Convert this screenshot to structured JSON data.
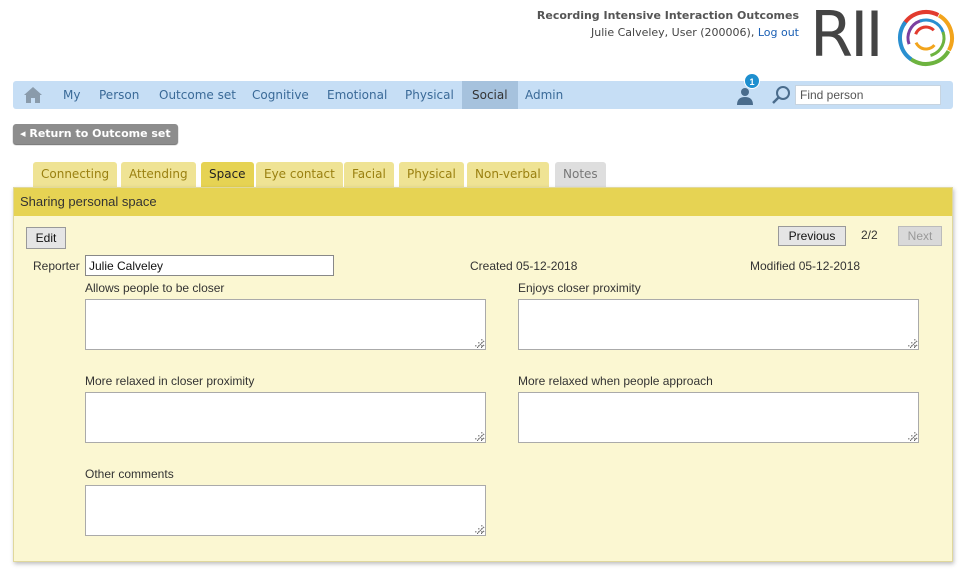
{
  "header": {
    "app_title": "Recording Intensive Interaction Outcomes",
    "user_text": "Julie Calveley, User (200006),",
    "logout_label": "Log out",
    "logo_text": "RII"
  },
  "nav": {
    "items": [
      {
        "label": "My"
      },
      {
        "label": "Person"
      },
      {
        "label": "Outcome set"
      },
      {
        "label": "Cognitive"
      },
      {
        "label": "Emotional"
      },
      {
        "label": "Physical"
      },
      {
        "label": "Social",
        "active": true
      },
      {
        "label": "Admin"
      }
    ],
    "notification_count": "1",
    "search_placeholder": "Find person"
  },
  "return_button": "◂ Return to Outcome set",
  "tabs": [
    {
      "label": "Connecting"
    },
    {
      "label": "Attending"
    },
    {
      "label": "Space",
      "active": true
    },
    {
      "label": "Eye contact"
    },
    {
      "label": "Facial"
    },
    {
      "label": "Physical"
    },
    {
      "label": "Non-verbal"
    },
    {
      "label": "Notes"
    }
  ],
  "panel": {
    "title": "Sharing personal space",
    "edit_label": "Edit",
    "previous_label": "Previous",
    "pager": "2/2",
    "next_label": "Next",
    "reporter_label": "Reporter",
    "reporter_value": "Julie Calveley",
    "created": "Created 05-12-2018",
    "modified": "Modified 05-12-2018",
    "fields": [
      {
        "label": "Allows people to be closer",
        "value": ""
      },
      {
        "label": "Enjoys closer proximity",
        "value": ""
      },
      {
        "label": "More relaxed in closer proximity",
        "value": ""
      },
      {
        "label": "More relaxed when people approach",
        "value": ""
      },
      {
        "label": "Other comments",
        "value": ""
      }
    ]
  },
  "colors": {
    "nav_bg": "#c6def5",
    "nav_active": "#a6c2dd",
    "tab_active": "#e6d353",
    "panel_bg": "#fbf7d2",
    "badge": "#1e8fcf"
  }
}
